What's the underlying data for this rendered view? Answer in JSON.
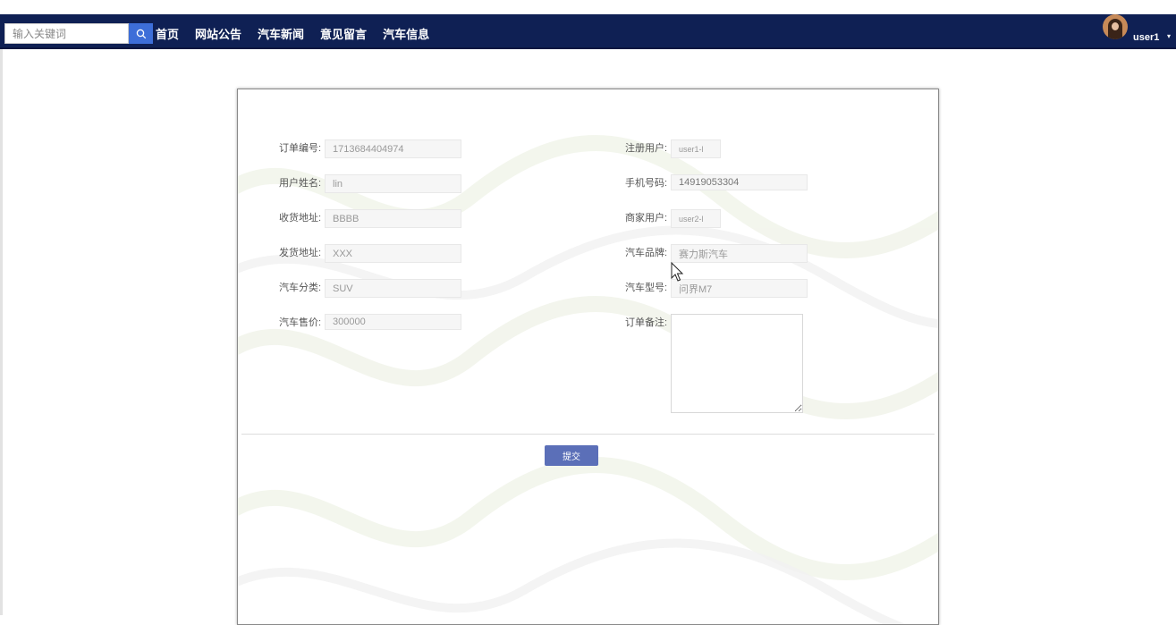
{
  "search": {
    "placeholder": "输入关键词"
  },
  "nav": {
    "items": [
      "首页",
      "网站公告",
      "汽车新闻",
      "意见留言",
      "汽车信息"
    ]
  },
  "user": {
    "name": "user1"
  },
  "form": {
    "left": [
      {
        "label": "订单编号:",
        "value": "1713684404974"
      },
      {
        "label": "用户姓名:",
        "value": "lin"
      },
      {
        "label": "收货地址:",
        "value": "BBBB"
      },
      {
        "label": "发货地址:",
        "value": "XXX"
      },
      {
        "label": "汽车分类:",
        "value": "SUV"
      },
      {
        "label": "汽车售价:",
        "value": "300000"
      }
    ],
    "right": [
      {
        "label": "注册用户:",
        "value": "user1-l"
      },
      {
        "label": "手机号码:",
        "value": "14919053304"
      },
      {
        "label": "商家用户:",
        "value": "user2-l"
      },
      {
        "label": "汽车品牌:",
        "value": "赛力斯汽车"
      },
      {
        "label": "汽车型号:",
        "value": "问界M7"
      },
      {
        "label": "订单备注:",
        "value": ""
      }
    ],
    "submit_label": "提交"
  },
  "colors": {
    "navbar": "#0f2054",
    "search_button": "#3d6ed8",
    "submit_button": "#5b6fb8"
  },
  "icons": [
    "search-icon",
    "chevron-down-icon",
    "avatar",
    "mouse-cursor-icon"
  ]
}
